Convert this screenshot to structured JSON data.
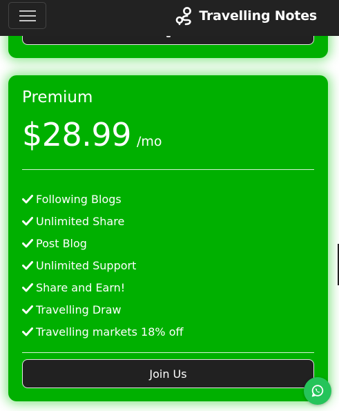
{
  "navbar": {
    "brand_name": "Travelling Notes",
    "brand_icon": "route-pin-icon",
    "menu_icon": "hamburger-menu-icon"
  },
  "plan": {
    "title": "Premium",
    "price": "$28.99",
    "period": "/mo",
    "features": [
      "Following Blogs",
      "Unlimited Share",
      "Post Blog",
      "Unlimited Support",
      "Share and Earn!",
      "Travelling Draw",
      "Travelling markets 18% off"
    ],
    "cta_label": "Join Us"
  },
  "floating": {
    "icon": "whatsapp-icon"
  },
  "colors": {
    "card_bg": "#00b000",
    "navbar_bg": "#222222",
    "button_bg": "#212121",
    "whatsapp_bg": "#25c45a"
  }
}
